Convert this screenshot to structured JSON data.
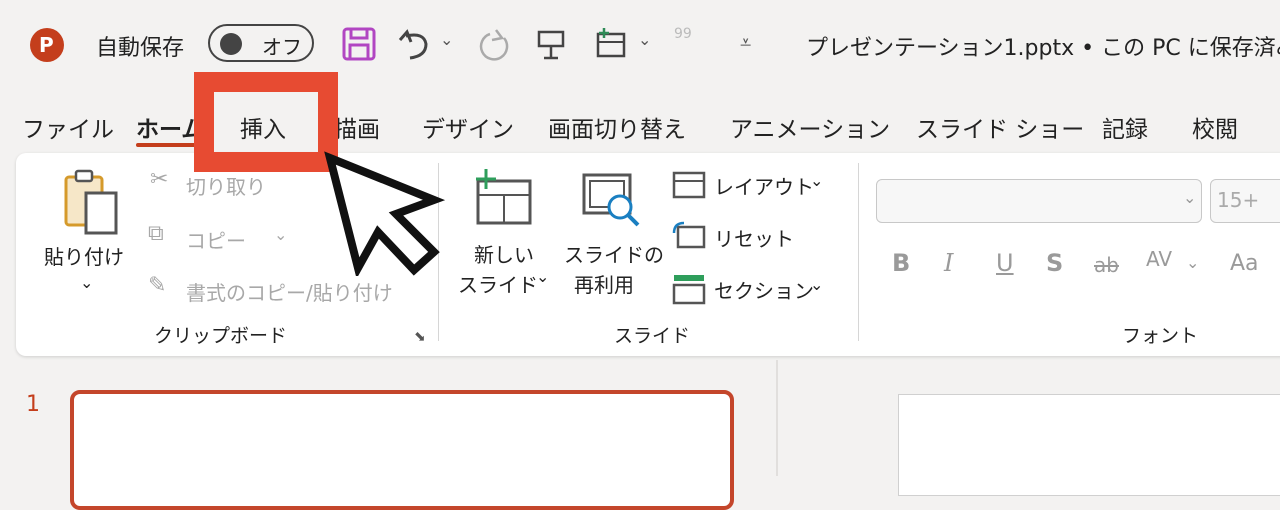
{
  "titlebar": {
    "app_icon_letter": "P",
    "autosave_label": "自動保存",
    "autosave_state": "オフ",
    "doc_title": "プレゼンテーション1.pptx • この PC に保存済み",
    "quick_more": "99"
  },
  "tabs": [
    {
      "label": "ファイル"
    },
    {
      "label": "ホーム"
    },
    {
      "label": "挿入"
    },
    {
      "label": "描画"
    },
    {
      "label": "デザイン"
    },
    {
      "label": "画面切り替え"
    },
    {
      "label": "アニメーション"
    },
    {
      "label": "スライド ショー"
    },
    {
      "label": "記録"
    },
    {
      "label": "校閲"
    }
  ],
  "clipboard": {
    "paste_label": "貼り付け",
    "cut_label": "切り取り",
    "copy_label": "コピー",
    "format_painter_label": "書式のコピー/貼り付け",
    "group_label": "クリップボード"
  },
  "slides_group": {
    "new_slide_line1": "新しい",
    "new_slide_line2": "スライド",
    "reuse_line1": "スライドの",
    "reuse_line2": "再利用",
    "layout_label": "レイアウト",
    "reset_label": "リセット",
    "section_label": "セクション",
    "group_label": "スライド"
  },
  "font_group": {
    "font_size": "15+",
    "bold": "B",
    "italic": "I",
    "underline": "U",
    "shadow": "S",
    "strike": "ab",
    "spacing": "AV",
    "case": "Aa",
    "group_label": "フォント"
  },
  "thumbnails": {
    "slide_number": "1"
  },
  "colors": {
    "accent": "#c43e1c",
    "highlight": "#e74b32",
    "save_icon": "#b146c2"
  }
}
